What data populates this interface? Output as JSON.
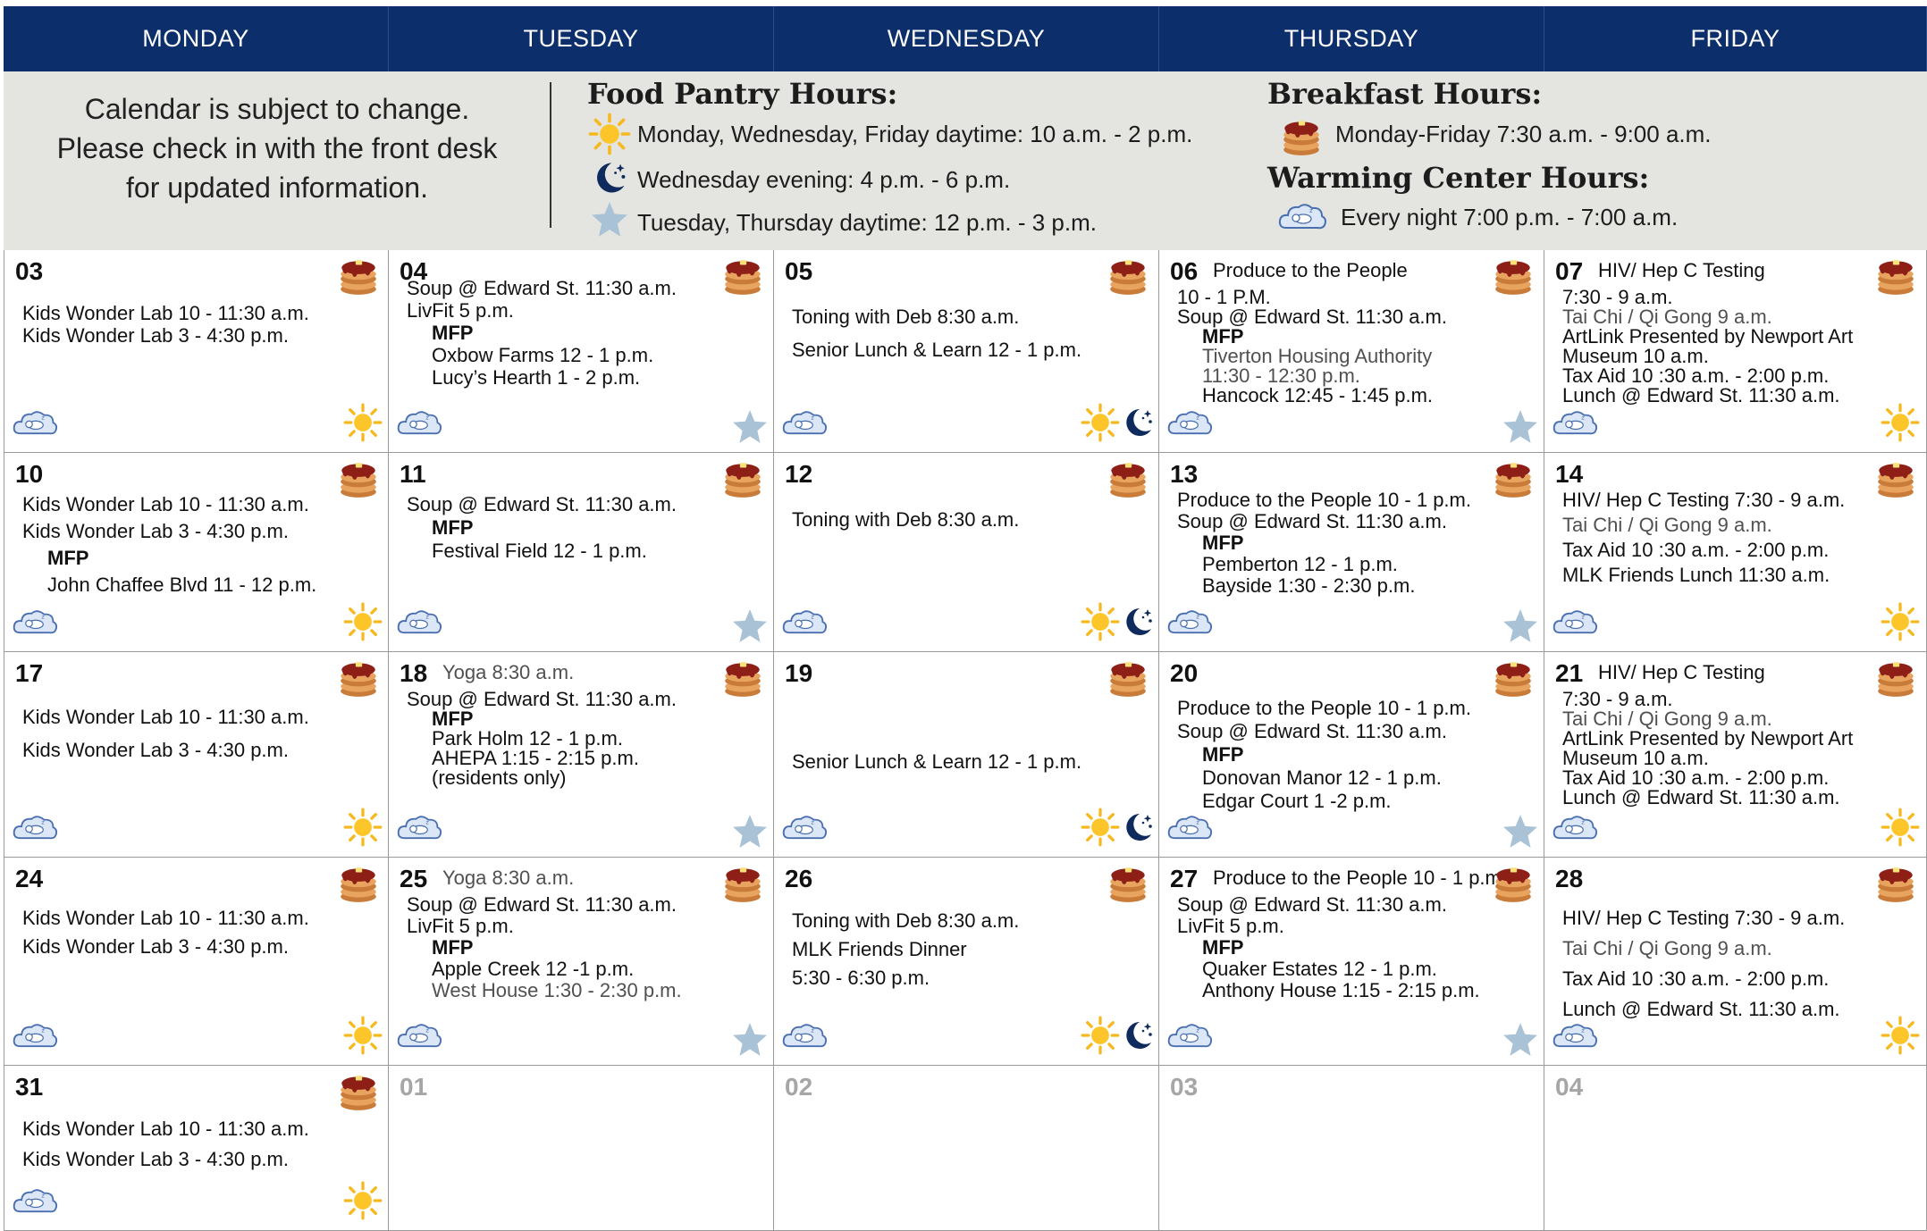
{
  "days": [
    "MONDAY",
    "TUESDAY",
    "WEDNESDAY",
    "THURSDAY",
    "FRIDAY"
  ],
  "notice": [
    "Calendar is subject to change.",
    "Please check in with the front desk",
    "for updated information."
  ],
  "food_pantry": {
    "title": "Food Pantry Hours:",
    "lines": [
      {
        "icon": "sun-icon",
        "text": "Monday, Wednesday, Friday daytime: 10 a.m. - 2 p.m."
      },
      {
        "icon": "moon-icon",
        "text": "Wednesday evening: 4 p.m. - 6 p.m."
      },
      {
        "icon": "star-icon",
        "text": "Tuesday, Thursday daytime: 12 p.m. - 3 p.m."
      }
    ]
  },
  "breakfast": {
    "title": "Breakfast Hours:",
    "icon": "pancake-icon",
    "text": "Monday-Friday 7:30 a.m. - 9:00 a.m."
  },
  "warming": {
    "title": "Warming Center Hours:",
    "icon": "sleeping-cloud-icon",
    "text": "Every night  7:00 p.m. - 7:00 a.m."
  },
  "weeks": [
    [
      {
        "day": "03",
        "events": [
          {
            "t": "Kids Wonder Lab 10 - 11:30 a.m."
          },
          {
            "t": "Kids Wonder Lab 3 - 4:30 p.m."
          }
        ],
        "icons": [
          "pancake-icon",
          "sleeping-cloud-icon",
          "sun-icon"
        ]
      },
      {
        "day": "04",
        "events": [
          {
            "t": "Soup @ Edward St. 11:30 a.m."
          },
          {
            "t": "LivFit 5 p.m."
          },
          {
            "t": "MFP",
            "b": 1
          },
          {
            "t": "Oxbow Farms 12 - 1 p.m."
          },
          {
            "t": "Lucy’s Hearth 1 - 2 p.m."
          }
        ],
        "icons": [
          "pancake-icon",
          "sleeping-cloud-icon",
          "star-icon"
        ]
      },
      {
        "day": "05",
        "events": [
          {
            "t": "Toning with Deb 8:30 a.m."
          },
          {
            "t": "Senior Lunch & Learn 12 - 1 p.m."
          }
        ],
        "icons": [
          "pancake-icon",
          "sleeping-cloud-icon",
          "sun-icon",
          "moon-icon"
        ]
      },
      {
        "day": "06",
        "events": [
          {
            "t": "Produce to the People"
          },
          {
            "t": "10 - 1 P.M."
          },
          {
            "t": "Soup @ Edward St. 11:30 a.m."
          },
          {
            "t": "MFP",
            "b": 1
          },
          {
            "t": "Tiverton Housing Authority",
            "g": 1
          },
          {
            "t": "11:30 - 12:30 p.m.",
            "g": 1
          },
          {
            "t": "Hancock 12:45 - 1:45 p.m."
          }
        ],
        "icons": [
          "pancake-icon",
          "sleeping-cloud-icon",
          "star-icon"
        ]
      },
      {
        "day": "07",
        "events": [
          {
            "t": "HIV/ Hep C Testing"
          },
          {
            "t": "7:30 - 9 a.m."
          },
          {
            "t": "Tai Chi / Qi Gong 9 a.m.",
            "g": 1
          },
          {
            "t": "ArtLink Presented by Newport Art"
          },
          {
            "t": "Museum 10 a.m."
          },
          {
            "t": "Tax Aid 10 :30 a.m. - 2:00 p.m."
          },
          {
            "t": "Lunch @ Edward St. 11:30 a.m."
          }
        ],
        "icons": [
          "pancake-icon",
          "sleeping-cloud-icon",
          "sun-icon"
        ]
      }
    ],
    [
      {
        "day": "10",
        "events": [
          {
            "t": "Kids Wonder Lab 10 - 11:30 a.m."
          },
          {
            "t": "Kids Wonder Lab 3 - 4:30 p.m."
          },
          {
            "t": "MFP",
            "b": 1
          },
          {
            "t": "John Chaffee Blvd 11 - 12 p.m."
          }
        ],
        "icons": [
          "pancake-icon",
          "sleeping-cloud-icon",
          "sun-icon"
        ]
      },
      {
        "day": "11",
        "events": [
          {
            "t": "Soup @ Edward St. 11:30 a.m."
          },
          {
            "t": "MFP",
            "b": 1
          },
          {
            "t": "Festival Field 12 - 1 p.m."
          }
        ],
        "icons": [
          "pancake-icon",
          "sleeping-cloud-icon",
          "star-icon"
        ]
      },
      {
        "day": "12",
        "events": [
          {
            "t": "Toning with Deb 8:30 a.m."
          }
        ],
        "icons": [
          "pancake-icon",
          "sleeping-cloud-icon",
          "sun-icon",
          "moon-icon"
        ]
      },
      {
        "day": "13",
        "events": [
          {
            "t": "Produce to the People 10 - 1 p.m."
          },
          {
            "t": "Soup @ Edward St. 11:30 a.m."
          },
          {
            "t": "MFP",
            "b": 1
          },
          {
            "t": "Pemberton 12 - 1 p.m."
          },
          {
            "t": "Bayside 1:30 - 2:30 p.m."
          }
        ],
        "icons": [
          "pancake-icon",
          "sleeping-cloud-icon",
          "star-icon"
        ]
      },
      {
        "day": "14",
        "events": [
          {
            "t": "HIV/ Hep C Testing 7:30 - 9 a.m."
          },
          {
            "t": "Tai Chi / Qi Gong 9 a.m.",
            "g": 1
          },
          {
            "t": "Tax Aid 10 :30 a.m. - 2:00 p.m."
          },
          {
            "t": "MLK Friends Lunch 11:30 a.m."
          }
        ],
        "icons": [
          "pancake-icon",
          "sleeping-cloud-icon",
          "sun-icon"
        ]
      }
    ],
    [
      {
        "day": "17",
        "events": [
          {
            "t": "Kids Wonder Lab 10 - 11:30 a.m."
          },
          {
            "t": "Kids Wonder Lab 3 - 4:30 p.m."
          }
        ],
        "icons": [
          "pancake-icon",
          "sleeping-cloud-icon",
          "sun-icon"
        ]
      },
      {
        "day": "18",
        "events": [
          {
            "t": "Yoga  8:30  a.m.",
            "g": 1
          },
          {
            "t": "Soup @ Edward St. 11:30 a.m."
          },
          {
            "t": "MFP",
            "b": 1
          },
          {
            "t": "Park Holm 12 - 1 p.m."
          },
          {
            "t": "AHEPA 1:15 - 2:15 p.m."
          },
          {
            "t": "(residents only)"
          }
        ],
        "icons": [
          "pancake-icon",
          "sleeping-cloud-icon",
          "star-icon"
        ]
      },
      {
        "day": "19",
        "events": [
          {
            "t": "Senior Lunch & Learn 12 - 1 p.m."
          }
        ],
        "icons": [
          "pancake-icon",
          "sleeping-cloud-icon",
          "sun-icon",
          "moon-icon"
        ]
      },
      {
        "day": "20",
        "events": [
          {
            "t": "Produce to the People 10 - 1 p.m."
          },
          {
            "t": "Soup @ Edward St. 11:30 a.m."
          },
          {
            "t": "MFP",
            "b": 1
          },
          {
            "t": "Donovan Manor 12 - 1 p.m."
          },
          {
            "t": "Edgar Court 1 -2 p.m."
          }
        ],
        "icons": [
          "pancake-icon",
          "sleeping-cloud-icon",
          "star-icon"
        ]
      },
      {
        "day": "21",
        "events": [
          {
            "t": "HIV/ Hep C Testing"
          },
          {
            "t": "7:30 - 9 a.m."
          },
          {
            "t": "Tai Chi / Qi Gong 9 a.m.",
            "g": 1
          },
          {
            "t": "ArtLink Presented by Newport Art"
          },
          {
            "t": "Museum 10 a.m."
          },
          {
            "t": "Tax Aid 10 :30 a.m. - 2:00 p.m."
          },
          {
            "t": "Lunch @ Edward St. 11:30 a.m."
          }
        ],
        "icons": [
          "pancake-icon",
          "sleeping-cloud-icon",
          "sun-icon"
        ]
      }
    ],
    [
      {
        "day": "24",
        "events": [
          {
            "t": "Kids Wonder Lab 10 - 11:30 a.m."
          },
          {
            "t": "Kids Wonder Lab 3 - 4:30 p.m."
          }
        ],
        "icons": [
          "pancake-icon",
          "sleeping-cloud-icon",
          "sun-icon"
        ]
      },
      {
        "day": "25",
        "events": [
          {
            "t": "Yoga  8:30  a.m.",
            "g": 1
          },
          {
            "t": "Soup @ Edward St. 11:30 a.m."
          },
          {
            "t": "LivFit 5 p.m."
          },
          {
            "t": "MFP",
            "b": 1
          },
          {
            "t": "Apple Creek 12 -1 p.m."
          },
          {
            "t": "West House 1:30 - 2:30 p.m.",
            "g": 1
          }
        ],
        "icons": [
          "pancake-icon",
          "sleeping-cloud-icon",
          "star-icon"
        ]
      },
      {
        "day": "26",
        "events": [
          {
            "t": "Toning with Deb 8:30 a.m."
          },
          {
            "t": "MLK Friends Dinner"
          },
          {
            "t": "5:30 - 6:30 p.m."
          }
        ],
        "icons": [
          "pancake-icon",
          "sleeping-cloud-icon",
          "sun-icon",
          "moon-icon"
        ]
      },
      {
        "day": "27",
        "events": [
          {
            "t": "Produce to the People 10 - 1 p.m."
          },
          {
            "t": "Soup @ Edward St. 11:30 a.m."
          },
          {
            "t": "LivFit 5 p.m."
          },
          {
            "t": "MFP",
            "b": 1
          },
          {
            "t": "Quaker Estates 12 - 1 p.m."
          },
          {
            "t": "Anthony House 1:15 - 2:15 p.m."
          }
        ],
        "icons": [
          "pancake-icon",
          "sleeping-cloud-icon",
          "star-icon"
        ]
      },
      {
        "day": "28",
        "events": [
          {
            "t": "HIV/ Hep C Testing 7:30 - 9 a.m."
          },
          {
            "t": "Tai Chi / Qi Gong 9 a.m.",
            "g": 1
          },
          {
            "t": "Tax Aid 10 :30 a.m. - 2:00 p.m."
          },
          {
            "t": "Lunch @ Edward St. 11:30 a.m."
          }
        ],
        "icons": [
          "pancake-icon",
          "sleeping-cloud-icon",
          "sun-icon"
        ]
      }
    ],
    [
      {
        "day": "31",
        "events": [
          {
            "t": "Kids Wonder Lab 10 - 11:30 a.m."
          },
          {
            "t": "Kids Wonder Lab 3 - 4:30 p.m."
          }
        ],
        "icons": [
          "pancake-icon",
          "sleeping-cloud-icon",
          "sun-icon"
        ]
      },
      {
        "day": "01",
        "grey": 1,
        "events": [],
        "icons": []
      },
      {
        "day": "02",
        "grey": 1,
        "events": [],
        "icons": []
      },
      {
        "day": "03",
        "grey": 1,
        "events": [],
        "icons": []
      },
      {
        "day": "04",
        "grey": 1,
        "events": [],
        "icons": []
      }
    ]
  ]
}
